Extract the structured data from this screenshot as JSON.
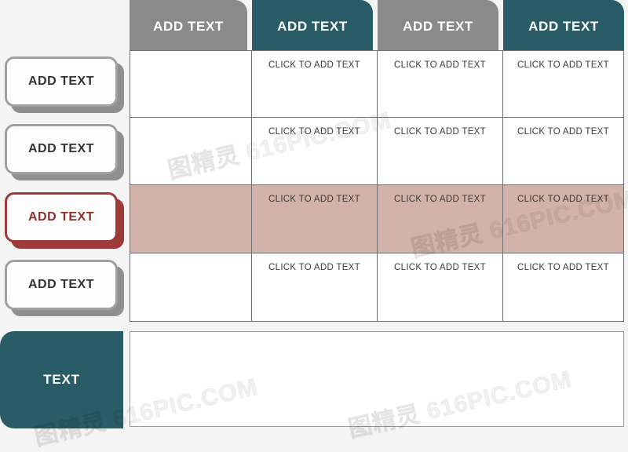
{
  "theme": {
    "background": "#f4f4f4",
    "header_gray": "#8a8a8a",
    "header_teal": "#2a5c68",
    "highlight_rose": "#d3b2a9",
    "accent_red": "#9e3a38",
    "card_gray": "#8f8f8f",
    "grid_line": "#6f6f6f",
    "cell_text": "#3a3a3a",
    "header_text": "#ffffff"
  },
  "table": {
    "column_headers": [
      {
        "label": "ADD TEXT",
        "style": "gray"
      },
      {
        "label": "ADD TEXT",
        "style": "teal"
      },
      {
        "label": "ADD TEXT",
        "style": "gray"
      },
      {
        "label": "ADD TEXT",
        "style": "teal"
      }
    ],
    "row_labels": [
      {
        "label": "ADD TEXT",
        "style": "gray"
      },
      {
        "label": "ADD TEXT",
        "style": "gray"
      },
      {
        "label": "ADD TEXT",
        "style": "accent"
      },
      {
        "label": "ADD TEXT",
        "style": "gray"
      }
    ],
    "cell_placeholder": "CLICK TO ADD TEXT",
    "rows": [
      {
        "highlighted": false,
        "cells": [
          "",
          "CLICK TO ADD TEXT",
          "CLICK TO ADD TEXT",
          "CLICK TO ADD TEXT"
        ]
      },
      {
        "highlighted": false,
        "cells": [
          "",
          "CLICK TO ADD TEXT",
          "CLICK TO ADD TEXT",
          "CLICK TO ADD TEXT"
        ]
      },
      {
        "highlighted": true,
        "cells": [
          "",
          "CLICK TO ADD TEXT",
          "CLICK TO ADD TEXT",
          "CLICK TO ADD TEXT"
        ]
      },
      {
        "highlighted": false,
        "cells": [
          "",
          "CLICK TO ADD TEXT",
          "CLICK TO ADD TEXT",
          "CLICK TO ADD TEXT"
        ]
      }
    ]
  },
  "footer": {
    "label": "TEXT",
    "panel_text": ""
  },
  "watermarks": [
    "图精灵 616PIC.COM",
    "图精灵 616PIC.COM",
    "图精灵 616PIC.COM",
    "图精灵 616PIC.COM"
  ]
}
